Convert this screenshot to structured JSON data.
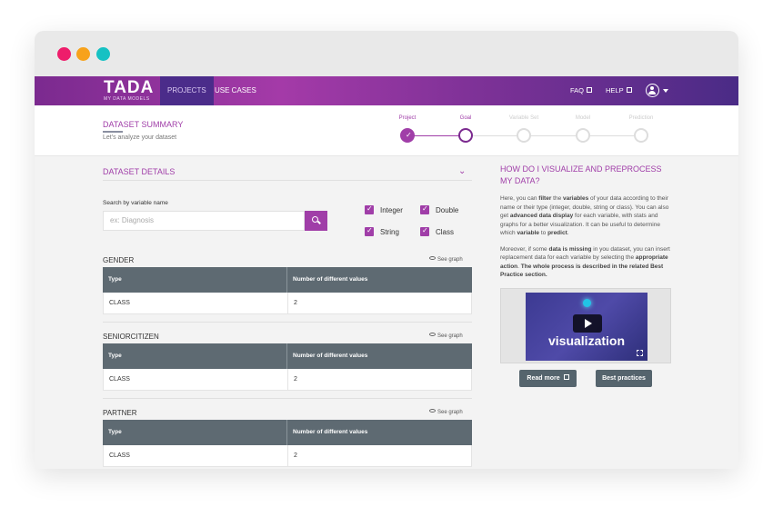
{
  "nav": {
    "logo": "TADA",
    "logo_sub": "MY DATA MODELS",
    "items": [
      {
        "label": "PROJECTS"
      },
      {
        "label": "USE CASES"
      }
    ],
    "faq": "FAQ",
    "help": "HELP"
  },
  "summary": {
    "title": "DATASET SUMMARY",
    "subtitle": "Let's analyze your dataset",
    "steps": [
      "Project",
      "Goal",
      "Variable Set",
      "Model",
      "Prediction"
    ]
  },
  "details": {
    "title": "DATASET DETAILS",
    "search_label": "Search by variable name",
    "search_placeholder": "ex: Diagnosis",
    "filters": [
      "Integer",
      "Double",
      "String",
      "Class"
    ]
  },
  "variables": [
    {
      "name": "GENDER",
      "see_graph": "See graph",
      "col_type": "Type",
      "col_count": "Number of different values",
      "type": "CLASS",
      "count": "2"
    },
    {
      "name": "SENIORCITIZEN",
      "see_graph": "See graph",
      "col_type": "Type",
      "col_count": "Number of different values",
      "type": "CLASS",
      "count": "2"
    },
    {
      "name": "PARTNER",
      "see_graph": "See graph",
      "col_type": "Type",
      "col_count": "Number of different values",
      "type": "CLASS",
      "count": "2"
    }
  ],
  "help": {
    "title": "HOW DO I VISUALIZE AND PREPROCESS MY DATA?",
    "video_word": "visualization",
    "read_more": "Read more",
    "best_practices": "Best practices"
  },
  "colors": {
    "accent": "#a03ea8",
    "table_header": "#5e6a72",
    "nav_active": "#4b2c8a"
  }
}
